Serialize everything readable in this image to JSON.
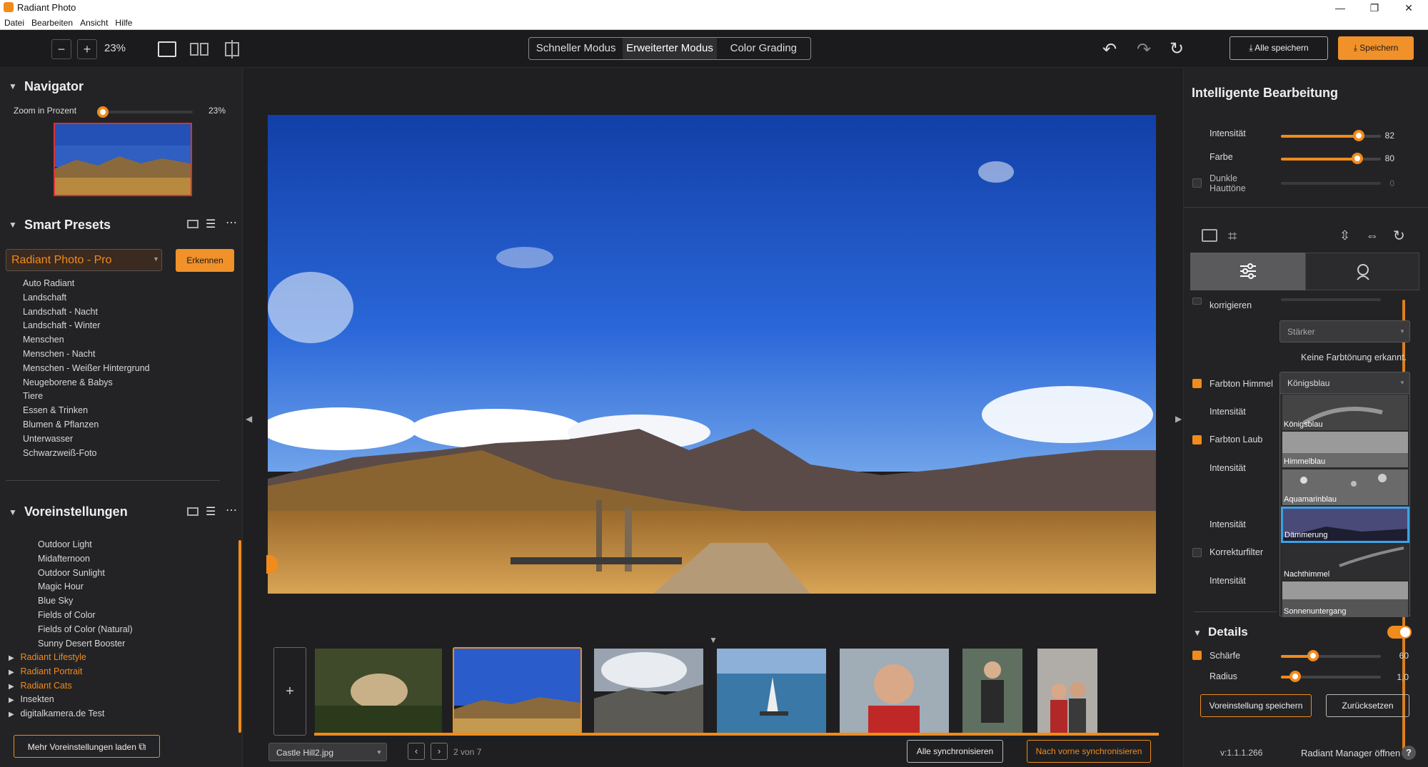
{
  "window": {
    "title": "Radiant Photo",
    "minimize": "—",
    "maximize": "❐",
    "close": "✕"
  },
  "menu": [
    "Datei",
    "Bearbeiten",
    "Ansicht",
    "Hilfe"
  ],
  "toolbar": {
    "zoom_out": "−",
    "zoom_in": "+",
    "zoom": "23%",
    "modes": [
      "Schneller Modus",
      "Erweiterter Modus",
      "Color Grading"
    ],
    "active_mode": "Erweiterter Modus",
    "undo": "↶",
    "redo": "↷",
    "reset": "↻",
    "save_all": "Alle speichern",
    "save": "Speichern"
  },
  "navigator": {
    "title": "Navigator",
    "zoom_label": "Zoom in Prozent",
    "zoom_value": "23%",
    "zoom_fraction": 0.0
  },
  "smart_presets": {
    "title": "Smart Presets",
    "selected": "Radiant Photo - Pro",
    "detect_button": "Erkennen",
    "items": [
      "Auto Radiant",
      "Landschaft",
      "Landschaft - Nacht",
      "Landschaft - Winter",
      "Menschen",
      "Menschen - Nacht",
      "Menschen - Weißer Hintergrund",
      "Neugeborene & Babys",
      "Tiere",
      "Essen & Trinken",
      "Blumen & Pflanzen",
      "Unterwasser",
      "Schwarzweiß-Foto"
    ]
  },
  "presets": {
    "title": "Voreinstellungen",
    "items": [
      "Outdoor Light",
      "Midafternoon",
      "Outdoor Sunlight",
      "Magic Hour",
      "Blue Sky",
      "Fields of Color",
      "Fields of Color (Natural)",
      "Sunny Desert Booster"
    ],
    "groups": [
      {
        "label": "Radiant Lifestyle",
        "accent": true
      },
      {
        "label": "Radiant Portrait",
        "accent": true
      },
      {
        "label": "Radiant Cats",
        "accent": true
      },
      {
        "label": "Insekten",
        "accent": false
      },
      {
        "label": "digitalkamera.de Test",
        "accent": false
      }
    ],
    "more_button": "Mehr Voreinstellungen laden"
  },
  "filmstrip": {
    "add": "+",
    "file": "Castle Hill2.jpg",
    "counter": "2 von 7",
    "sync_all": "Alle synchronisieren",
    "sync_forward": "Nach vorne synchronisieren"
  },
  "smart_edit": {
    "title": "Intelligente Bearbeitung",
    "intensity_label": "Intensität",
    "intensity_value": "82",
    "intensity": 82,
    "color_label": "Farbe",
    "color_value": "80",
    "color": 80,
    "skin_label_1": "Dunkle",
    "skin_label_2": "Hauttöne",
    "skin_value": "0"
  },
  "adjustments": {
    "korrigieren": "korrigieren",
    "strength_select": "Stärker",
    "no_tone": "Keine Farbtönung erkannt.",
    "sky_label": "Farbton Himmel",
    "sky_value": "Königsblau",
    "intensity_label": "Intensität",
    "foliage_label": "Farbton Laub",
    "filter_label": "Korrekturfilter",
    "sky_options": [
      "Königsblau",
      "Himmelblau",
      "Aquamarinblau",
      "Dämmerung",
      "Nachthimmel",
      "Sonnenuntergang"
    ],
    "highlighted_option": "Dämmerung"
  },
  "details": {
    "title": "Details",
    "sharpness_label": "Schärfe",
    "sharpness_value": "60",
    "sharpness": 60,
    "radius_label": "Radius",
    "radius_value": "1,0",
    "radius": 0.1,
    "save_preset": "Voreinstellung speichern",
    "reset": "Zurücksetzen"
  },
  "footer": {
    "version": "v:1.1.1.266",
    "manager": "Radiant Manager öffnen",
    "help": "?"
  },
  "colors": {
    "accent": "#f08b1c",
    "bg": "#1f1f21",
    "panel": "#232325",
    "highlight": "#39a3e6"
  }
}
